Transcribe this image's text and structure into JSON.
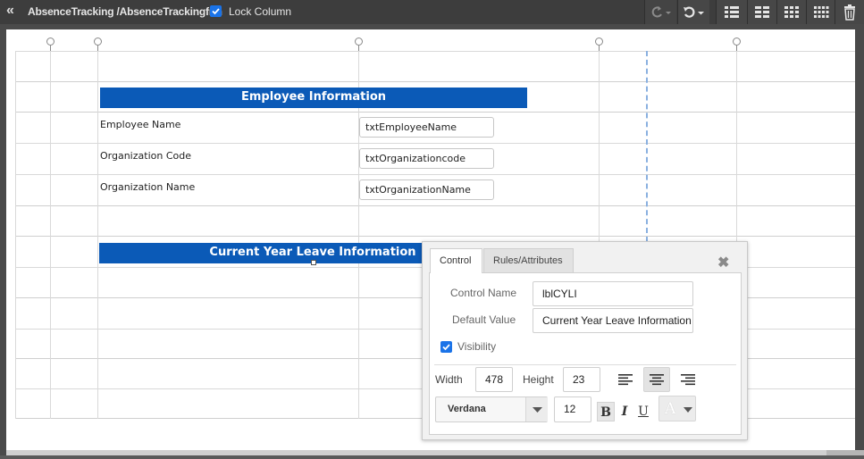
{
  "toolbar": {
    "back_icon": "double-chevron-left-icon",
    "title": "AbsenceTracking /AbsenceTrackingfrm",
    "lock_column_label": "Lock Column",
    "lock_column_checked": true,
    "buttons": [
      "redo-icon",
      "undo-icon",
      "layout-grid-1-icon",
      "layout-grid-2-icon",
      "layout-grid-3-icon",
      "layout-grid-4-icon",
      "trash-icon"
    ]
  },
  "form": {
    "section1_title": "Employee Information",
    "fields": [
      {
        "label": "Employee Name",
        "value": "txtEmployeeName"
      },
      {
        "label": "Organization Code",
        "value": "txtOrganizationcode"
      },
      {
        "label": "Organization Name",
        "value": "txtOrganizationName"
      }
    ],
    "section2_title": "Current Year Leave Information"
  },
  "popup": {
    "tabs": [
      {
        "label": "Control",
        "active": true
      },
      {
        "label": "Rules/Attributes",
        "active": false
      }
    ],
    "control_name_label": "Control Name",
    "control_name_value": "lblCYLI",
    "default_value_label": "Default Value",
    "default_value_value": "Current Year Leave Information",
    "visibility_label": "Visibility",
    "visibility_checked": true,
    "width_label": "Width",
    "width_value": "478",
    "height_label": "Height",
    "height_value": "23",
    "alignment_selected": "center",
    "font_family": "Verdana",
    "font_size": "12",
    "bold_label": "B",
    "italic_label": "I",
    "underline_label": "U",
    "color_label": "A"
  },
  "colors": {
    "accent": "#1a73e8",
    "section_header": "#0b5ab7",
    "topbar": "#3d3d3d"
  }
}
